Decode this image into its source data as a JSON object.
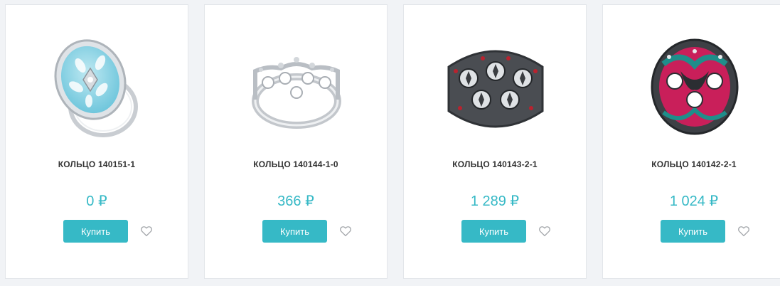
{
  "products": [
    {
      "title": "КОЛЬЦО 140151-1",
      "price": "0 ₽",
      "buy_label": "Купить",
      "image": "ring-blue-enamel",
      "fav_icon": "heart-outline-icon"
    },
    {
      "title": "КОЛЬЦО 140144-1-0",
      "price": "366 ₽",
      "buy_label": "Купить",
      "image": "ring-silver-crown",
      "fav_icon": "heart-outline-icon"
    },
    {
      "title": "КОЛЬЦО 140143-2-1",
      "price": "1 289 ₽",
      "buy_label": "Купить",
      "image": "ring-black-openwork",
      "fav_icon": "heart-outline-icon"
    },
    {
      "title": "КОЛЬЦО 140142-2-1",
      "price": "1 024 ₽",
      "buy_label": "Купить",
      "image": "ring-pink-enamel",
      "fav_icon": "heart-outline-icon"
    }
  ],
  "colors": {
    "accent": "#36b9c6",
    "title": "#333333",
    "background": "#f1f3f6",
    "card_border": "#e3e6ea"
  }
}
